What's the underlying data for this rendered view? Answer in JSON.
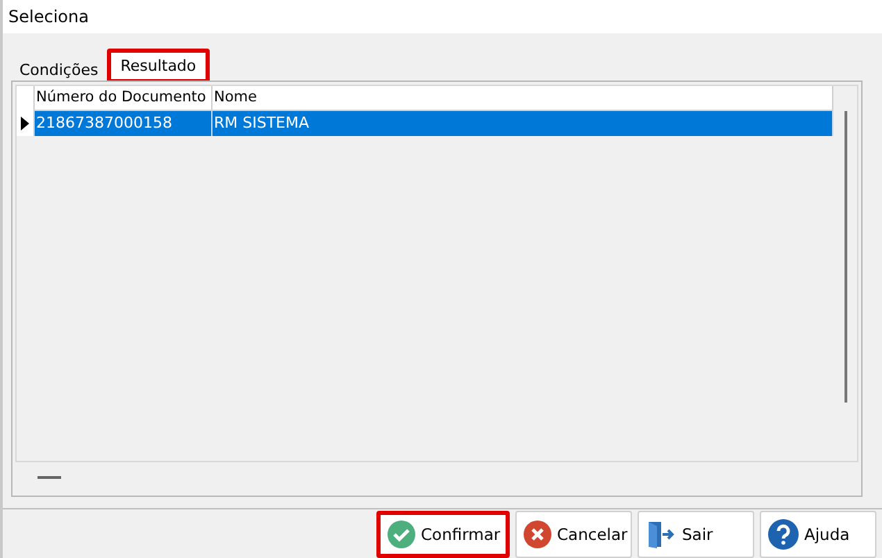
{
  "window": {
    "title": "Seleciona"
  },
  "tabs": [
    {
      "label": "Condições",
      "selected": false,
      "highlighted": false
    },
    {
      "label": "Resultado",
      "selected": true,
      "highlighted": true
    }
  ],
  "table": {
    "columns": [
      "Número do Documento",
      "Nome"
    ],
    "rows": [
      {
        "cells": [
          "21867387000158",
          "RM SISTEMA"
        ],
        "selected": true
      }
    ]
  },
  "buttons": [
    {
      "label": "Confirmar",
      "kind": "confirm",
      "highlighted": true
    },
    {
      "label": "Cancelar",
      "kind": "cancel",
      "highlighted": false
    },
    {
      "label": "Sair",
      "kind": "exit",
      "highlighted": false
    },
    {
      "label": "Ajuda",
      "kind": "help",
      "highlighted": false
    }
  ]
}
